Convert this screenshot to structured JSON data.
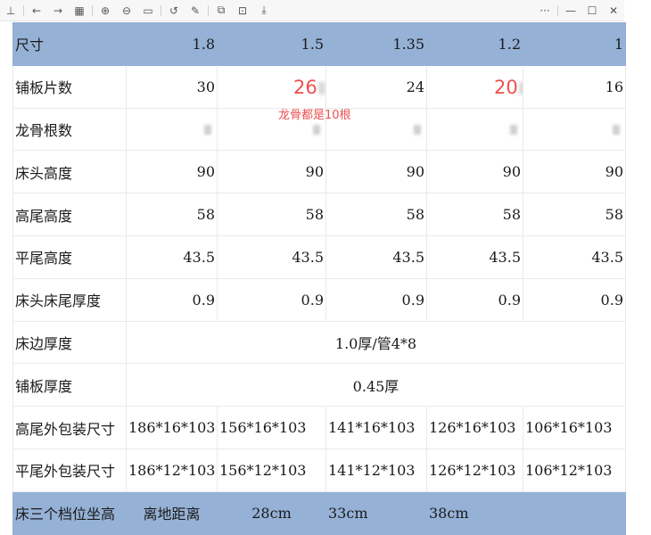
{
  "toolbar": {
    "buttons": [
      {
        "name": "pin-icon",
        "glyph": "⊥"
      },
      {
        "name": "back-icon",
        "glyph": "←"
      },
      {
        "name": "forward-icon",
        "glyph": "→"
      },
      {
        "name": "grid-view-icon",
        "glyph": "▦"
      },
      {
        "name": "zoom-in-icon",
        "glyph": "⊕"
      },
      {
        "name": "zoom-out-icon",
        "glyph": "⊖"
      },
      {
        "name": "actual-size-icon",
        "glyph": "▭"
      },
      {
        "name": "rotate-icon",
        "glyph": "↺"
      },
      {
        "name": "edit-icon",
        "glyph": "✎"
      },
      {
        "name": "copy-icon",
        "glyph": "⧉"
      },
      {
        "name": "crop-icon",
        "glyph": "⊡"
      },
      {
        "name": "download-icon",
        "glyph": "⤓"
      }
    ],
    "more": "···",
    "minimize": "—",
    "maximize": "☐",
    "close": "✕"
  },
  "table": {
    "header": {
      "label": "尺寸",
      "values": [
        "1.8",
        "1.5",
        "1.35",
        "1.2",
        "1"
      ]
    },
    "rows": [
      {
        "label": "铺板片数",
        "values": [
          "30",
          "26",
          "24",
          "20",
          "16"
        ]
      },
      {
        "label": "龙骨根数",
        "values": [
          "",
          "",
          "",
          "",
          ""
        ]
      },
      {
        "label": "床头高度",
        "values": [
          "90",
          "90",
          "90",
          "90",
          "90"
        ]
      },
      {
        "label": "高尾高度",
        "values": [
          "58",
          "58",
          "58",
          "58",
          "58"
        ]
      },
      {
        "label": "平尾高度",
        "values": [
          "43.5",
          "43.5",
          "43.5",
          "43.5",
          "43.5"
        ]
      },
      {
        "label": "床头床尾厚度",
        "values": [
          "0.9",
          "0.9",
          "0.9",
          "0.9",
          "0.9"
        ]
      }
    ],
    "edge_thickness": {
      "label": "床边厚度",
      "value": "1.0厚/管4*8"
    },
    "board_thickness": {
      "label": "铺板厚度",
      "value": "0.45厚"
    },
    "high_tail_pack": {
      "label": "高尾外包装尺寸",
      "values": [
        "186*16*103",
        "156*16*103",
        "141*16*103",
        "126*16*103",
        "106*16*103"
      ]
    },
    "flat_tail_pack": {
      "label": "平尾外包装尺寸",
      "values": [
        "186*12*103",
        "156*12*103",
        "141*12*103",
        "126*12*103",
        "106*12*103"
      ]
    },
    "last_row": {
      "label": "床三个档位坐高",
      "values": [
        "离地距离",
        "28cm",
        "33cm",
        "38cm",
        ""
      ]
    }
  },
  "annotation": "龙骨都是10根",
  "colors": {
    "header_bg": "#95b1d6",
    "annotation_red": "#ef4f4f"
  }
}
